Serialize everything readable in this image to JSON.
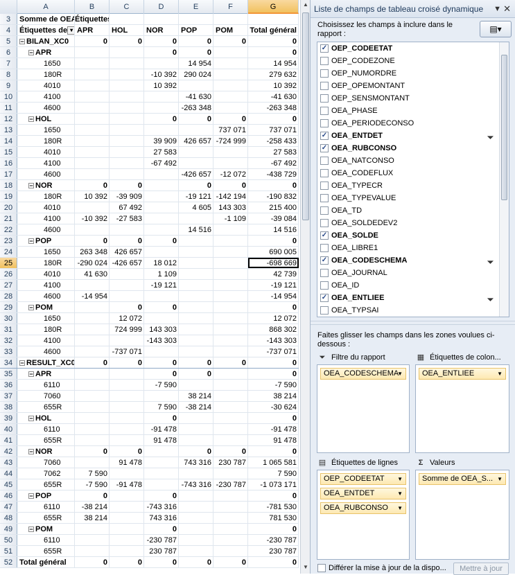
{
  "columns": [
    "A",
    "B",
    "C",
    "D",
    "E",
    "F",
    "G"
  ],
  "active_col": "G",
  "active_row": "25",
  "rows": [
    {
      "n": "3",
      "a": "Somme de OEA_",
      "b": "Étiquettes",
      "c": "",
      "d": "",
      "e": "",
      "f": "",
      "g": "",
      "t": "hdr1"
    },
    {
      "n": "4",
      "a": "Étiquettes de",
      "b": "APR",
      "c": "HOL",
      "d": "NOR",
      "e": "POP",
      "f": "POM",
      "g": "Total général",
      "t": "hdr2"
    },
    {
      "n": "5",
      "a": "BILAN_XC0",
      "b": "0",
      "c": "0",
      "d": "0",
      "e": "0",
      "f": "0",
      "g": "0",
      "t": "l1"
    },
    {
      "n": "6",
      "a": "APR",
      "b": "",
      "c": "",
      "d": "0",
      "e": "0",
      "f": "",
      "g": "0",
      "t": "l2"
    },
    {
      "n": "7",
      "a": "1650",
      "b": "",
      "c": "",
      "d": "",
      "e": "14 954",
      "f": "",
      "g": "14 954",
      "t": "l3"
    },
    {
      "n": "8",
      "a": "180R",
      "b": "",
      "c": "",
      "d": "-10 392",
      "e": "290 024",
      "f": "",
      "g": "279 632",
      "t": "l3"
    },
    {
      "n": "9",
      "a": "4010",
      "b": "",
      "c": "",
      "d": "10 392",
      "e": "",
      "f": "",
      "g": "10 392",
      "t": "l3"
    },
    {
      "n": "10",
      "a": "4100",
      "b": "",
      "c": "",
      "d": "",
      "e": "-41 630",
      "f": "",
      "g": "-41 630",
      "t": "l3"
    },
    {
      "n": "11",
      "a": "4600",
      "b": "",
      "c": "",
      "d": "",
      "e": "-263 348",
      "f": "",
      "g": "-263 348",
      "t": "l3"
    },
    {
      "n": "12",
      "a": "HOL",
      "b": "",
      "c": "",
      "d": "0",
      "e": "0",
      "f": "0",
      "g": "0",
      "t": "l2"
    },
    {
      "n": "13",
      "a": "1650",
      "b": "",
      "c": "",
      "d": "",
      "e": "",
      "f": "737 071",
      "g": "737 071",
      "t": "l3"
    },
    {
      "n": "14",
      "a": "180R",
      "b": "",
      "c": "",
      "d": "39 909",
      "e": "426 657",
      "f": "-724 999",
      "g": "-258 433",
      "t": "l3"
    },
    {
      "n": "15",
      "a": "4010",
      "b": "",
      "c": "",
      "d": "27 583",
      "e": "",
      "f": "",
      "g": "27 583",
      "t": "l3"
    },
    {
      "n": "16",
      "a": "4100",
      "b": "",
      "c": "",
      "d": "-67 492",
      "e": "",
      "f": "",
      "g": "-67 492",
      "t": "l3"
    },
    {
      "n": "17",
      "a": "4600",
      "b": "",
      "c": "",
      "d": "",
      "e": "-426 657",
      "f": "-12 072",
      "g": "-438 729",
      "t": "l3"
    },
    {
      "n": "18",
      "a": "NOR",
      "b": "0",
      "c": "0",
      "d": "",
      "e": "0",
      "f": "0",
      "g": "0",
      "t": "l2"
    },
    {
      "n": "19",
      "a": "180R",
      "b": "10 392",
      "c": "-39 909",
      "d": "",
      "e": "-19 121",
      "f": "-142 194",
      "g": "-190 832",
      "t": "l3"
    },
    {
      "n": "20",
      "a": "4010",
      "b": "",
      "c": "67 492",
      "d": "",
      "e": "4 605",
      "f": "143 303",
      "g": "215 400",
      "t": "l3"
    },
    {
      "n": "21",
      "a": "4100",
      "b": "-10 392",
      "c": "-27 583",
      "d": "",
      "e": "",
      "f": "-1 109",
      "g": "-39 084",
      "t": "l3"
    },
    {
      "n": "22",
      "a": "4600",
      "b": "",
      "c": "",
      "d": "",
      "e": "14 516",
      "f": "",
      "g": "14 516",
      "t": "l3"
    },
    {
      "n": "23",
      "a": "POP",
      "b": "0",
      "c": "0",
      "d": "0",
      "e": "",
      "f": "",
      "g": "0",
      "t": "l2"
    },
    {
      "n": "24",
      "a": "1650",
      "b": "263 348",
      "c": "426 657",
      "d": "",
      "e": "",
      "f": "",
      "g": "690 005",
      "t": "l3"
    },
    {
      "n": "25",
      "a": "180R",
      "b": "-290 024",
      "c": "-426 657",
      "d": "18 012",
      "e": "",
      "f": "",
      "g": "-698 669",
      "t": "l3"
    },
    {
      "n": "26",
      "a": "4010",
      "b": "41 630",
      "c": "",
      "d": "1 109",
      "e": "",
      "f": "",
      "g": "42 739",
      "t": "l3"
    },
    {
      "n": "27",
      "a": "4100",
      "b": "",
      "c": "",
      "d": "-19 121",
      "e": "",
      "f": "",
      "g": "-19 121",
      "t": "l3"
    },
    {
      "n": "28",
      "a": "4600",
      "b": "-14 954",
      "c": "",
      "d": "",
      "e": "",
      "f": "",
      "g": "-14 954",
      "t": "l3"
    },
    {
      "n": "29",
      "a": "POM",
      "b": "",
      "c": "0",
      "d": "0",
      "e": "",
      "f": "",
      "g": "0",
      "t": "l2"
    },
    {
      "n": "30",
      "a": "1650",
      "b": "",
      "c": "12 072",
      "d": "",
      "e": "",
      "f": "",
      "g": "12 072",
      "t": "l3"
    },
    {
      "n": "31",
      "a": "180R",
      "b": "",
      "c": "724 999",
      "d": "143 303",
      "e": "",
      "f": "",
      "g": "868 302",
      "t": "l3"
    },
    {
      "n": "32",
      "a": "4100",
      "b": "",
      "c": "",
      "d": "-143 303",
      "e": "",
      "f": "",
      "g": "-143 303",
      "t": "l3"
    },
    {
      "n": "33",
      "a": "4600",
      "b": "",
      "c": "-737 071",
      "d": "",
      "e": "",
      "f": "",
      "g": "-737 071",
      "t": "l3"
    },
    {
      "n": "34",
      "a": "RESULT_XC0",
      "b": "0",
      "c": "0",
      "d": "0",
      "e": "0",
      "f": "0",
      "g": "0",
      "t": "l1"
    },
    {
      "n": "35",
      "a": "APR",
      "b": "",
      "c": "",
      "d": "0",
      "e": "0",
      "f": "",
      "g": "0",
      "t": "l2"
    },
    {
      "n": "36",
      "a": "6110",
      "b": "",
      "c": "",
      "d": "-7 590",
      "e": "",
      "f": "",
      "g": "-7 590",
      "t": "l3"
    },
    {
      "n": "37",
      "a": "7060",
      "b": "",
      "c": "",
      "d": "",
      "e": "38 214",
      "f": "",
      "g": "38 214",
      "t": "l3"
    },
    {
      "n": "38",
      "a": "655R",
      "b": "",
      "c": "",
      "d": "7 590",
      "e": "-38 214",
      "f": "",
      "g": "-30 624",
      "t": "l3"
    },
    {
      "n": "39",
      "a": "HOL",
      "b": "",
      "c": "",
      "d": "0",
      "e": "",
      "f": "",
      "g": "0",
      "t": "l2"
    },
    {
      "n": "40",
      "a": "6110",
      "b": "",
      "c": "",
      "d": "-91 478",
      "e": "",
      "f": "",
      "g": "-91 478",
      "t": "l3"
    },
    {
      "n": "41",
      "a": "655R",
      "b": "",
      "c": "",
      "d": "91 478",
      "e": "",
      "f": "",
      "g": "91 478",
      "t": "l3"
    },
    {
      "n": "42",
      "a": "NOR",
      "b": "0",
      "c": "0",
      "d": "",
      "e": "0",
      "f": "0",
      "g": "0",
      "t": "l2"
    },
    {
      "n": "43",
      "a": "7060",
      "b": "",
      "c": "91 478",
      "d": "",
      "e": "743 316",
      "f": "230 787",
      "g": "1 065 581",
      "t": "l3"
    },
    {
      "n": "44",
      "a": "7062",
      "b": "7 590",
      "c": "",
      "d": "",
      "e": "",
      "f": "",
      "g": "7 590",
      "t": "l3"
    },
    {
      "n": "45",
      "a": "655R",
      "b": "-7 590",
      "c": "-91 478",
      "d": "",
      "e": "-743 316",
      "f": "-230 787",
      "g": "-1 073 171",
      "t": "l3"
    },
    {
      "n": "46",
      "a": "POP",
      "b": "0",
      "c": "",
      "d": "0",
      "e": "",
      "f": "",
      "g": "0",
      "t": "l2"
    },
    {
      "n": "47",
      "a": "6110",
      "b": "-38 214",
      "c": "",
      "d": "-743 316",
      "e": "",
      "f": "",
      "g": "-781 530",
      "t": "l3"
    },
    {
      "n": "48",
      "a": "655R",
      "b": "38 214",
      "c": "",
      "d": "743 316",
      "e": "",
      "f": "",
      "g": "781 530",
      "t": "l3"
    },
    {
      "n": "49",
      "a": "POM",
      "b": "",
      "c": "",
      "d": "0",
      "e": "",
      "f": "",
      "g": "0",
      "t": "l2"
    },
    {
      "n": "50",
      "a": "6110",
      "b": "",
      "c": "",
      "d": "-230 787",
      "e": "",
      "f": "",
      "g": "-230 787",
      "t": "l3"
    },
    {
      "n": "51",
      "a": "655R",
      "b": "",
      "c": "",
      "d": "230 787",
      "e": "",
      "f": "",
      "g": "230 787",
      "t": "l3"
    },
    {
      "n": "52",
      "a": "Total général",
      "b": "0",
      "c": "0",
      "d": "0",
      "e": "0",
      "f": "0",
      "g": "0",
      "t": "total"
    }
  ],
  "panel": {
    "title": "Liste de champs de tableau croisé dynamique",
    "choose_text": "Choisissez les champs à inclure dans le rapport :",
    "fields": [
      {
        "label": "OEP_CODEETAT",
        "checked": true,
        "filter": false
      },
      {
        "label": "OEP_CODEZONE",
        "checked": false,
        "filter": false
      },
      {
        "label": "OEP_NUMORDRE",
        "checked": false,
        "filter": false
      },
      {
        "label": "OEP_OPEMONTANT",
        "checked": false,
        "filter": false
      },
      {
        "label": "OEP_SENSMONTANT",
        "checked": false,
        "filter": false
      },
      {
        "label": "OEA_PHASE",
        "checked": false,
        "filter": false
      },
      {
        "label": "OEA_PERIODECONSO",
        "checked": false,
        "filter": false
      },
      {
        "label": "OEA_ENTDET",
        "checked": true,
        "filter": true
      },
      {
        "label": "OEA_RUBCONSO",
        "checked": true,
        "filter": false
      },
      {
        "label": "OEA_NATCONSO",
        "checked": false,
        "filter": false
      },
      {
        "label": "OEA_CODEFLUX",
        "checked": false,
        "filter": false
      },
      {
        "label": "OEA_TYPECR",
        "checked": false,
        "filter": false
      },
      {
        "label": "OEA_TYPEVALUE",
        "checked": false,
        "filter": false
      },
      {
        "label": "OEA_TD",
        "checked": false,
        "filter": false
      },
      {
        "label": "OEA_SOLDEDEV2",
        "checked": false,
        "filter": false
      },
      {
        "label": "OEA_SOLDE",
        "checked": true,
        "filter": false
      },
      {
        "label": "OEA_LIBRE1",
        "checked": false,
        "filter": false
      },
      {
        "label": "OEA_CODESCHEMA",
        "checked": true,
        "filter": true
      },
      {
        "label": "OEA_JOURNAL",
        "checked": false,
        "filter": false
      },
      {
        "label": "OEA_ID",
        "checked": false,
        "filter": false
      },
      {
        "label": "OEA_ENTLIEE",
        "checked": true,
        "filter": true
      },
      {
        "label": "OEA_TYPSAI",
        "checked": false,
        "filter": false
      }
    ],
    "drag_text": "Faites glisser les champs dans les zones voulues ci-dessous :",
    "zone_filter_label": "Filtre du rapport",
    "zone_columns_label": "Étiquettes de colon...",
    "zone_rows_label": "Étiquettes de lignes",
    "zone_values_label": "Valeurs",
    "filter_items": [
      "OEA_CODESCHEMA"
    ],
    "column_items": [
      "OEA_ENTLIEE"
    ],
    "row_items": [
      "OEP_CODEETAT",
      "OEA_ENTDET",
      "OEA_RUBCONSO"
    ],
    "value_items": [
      "Somme de OEA_S..."
    ],
    "defer_label": "Différer la mise à jour de la dispo...",
    "update_label": "Mettre à jour"
  }
}
